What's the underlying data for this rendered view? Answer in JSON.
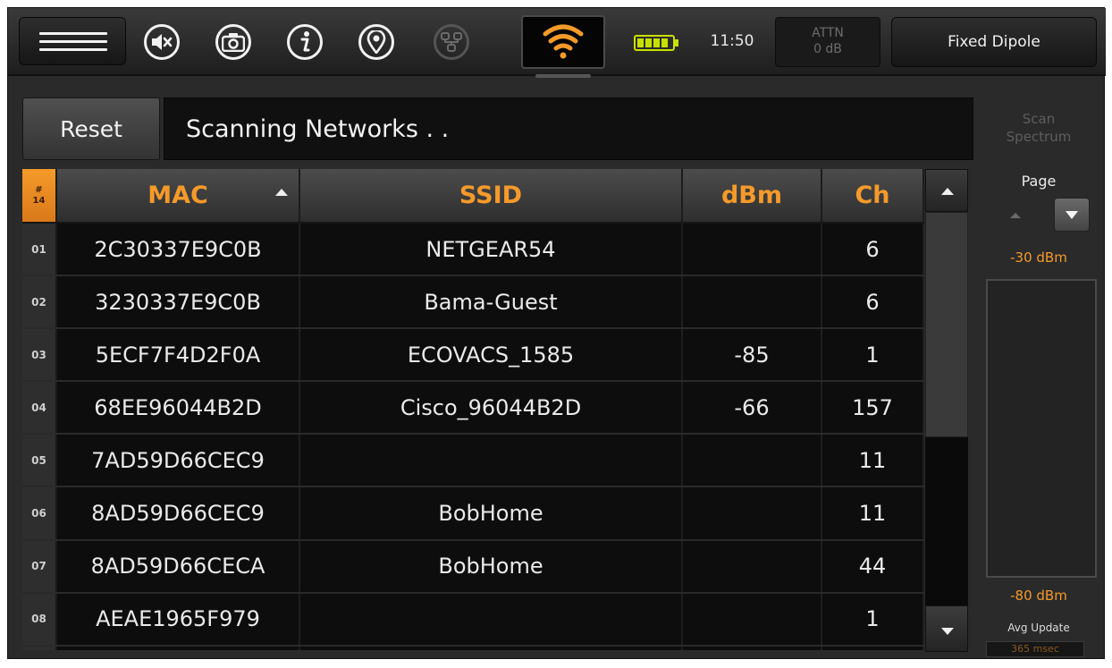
{
  "toolbar": {
    "icons": [
      "menu-icon",
      "mute-icon",
      "camera-icon",
      "info-icon",
      "location-icon",
      "network-icon",
      "wifi-icon",
      "battery-icon"
    ],
    "clock": "11:50",
    "attn_label": "ATTN",
    "attn_value": "0 dB",
    "antenna_mode": "Fixed Dipole"
  },
  "colors": {
    "accent": "#f59a2a",
    "panel": "#2a2a2a",
    "cell": "#0d0d0d",
    "battery": "#c8e000"
  },
  "controls": {
    "reset_label": "Reset",
    "status_text": "Scanning Networks . ."
  },
  "table": {
    "count_symbol": "#",
    "count": "14",
    "columns": [
      "MAC",
      "SSID",
      "dBm",
      "Ch"
    ],
    "sort_column": "MAC",
    "sort_direction": "ascending",
    "rows": [
      {
        "num": "01",
        "mac": "2C30337E9C0B",
        "ssid": "NETGEAR54",
        "dbm": "",
        "ch": "6"
      },
      {
        "num": "02",
        "mac": "3230337E9C0B",
        "ssid": "Bama-Guest",
        "dbm": "",
        "ch": "6"
      },
      {
        "num": "03",
        "mac": "5ECF7F4D2F0A",
        "ssid": "ECOVACS_1585",
        "dbm": "-85",
        "ch": "1"
      },
      {
        "num": "04",
        "mac": "68EE96044B2D",
        "ssid": "Cisco_96044B2D",
        "dbm": "-66",
        "ch": "157"
      },
      {
        "num": "05",
        "mac": "7AD59D66CEC9",
        "ssid": "",
        "dbm": "",
        "ch": "11"
      },
      {
        "num": "06",
        "mac": "8AD59D66CEC9",
        "ssid": "BobHome",
        "dbm": "",
        "ch": "11"
      },
      {
        "num": "07",
        "mac": "8AD59D66CECA",
        "ssid": "BobHome",
        "dbm": "",
        "ch": "44"
      },
      {
        "num": "08",
        "mac": "AEAE1965F979",
        "ssid": "",
        "dbm": "",
        "ch": "1"
      }
    ],
    "scroll_fraction_visible": 0.57
  },
  "side_panel": {
    "scan_spectrum_line1": "Scan",
    "scan_spectrum_line2": "Spectrum",
    "page_label": "Page",
    "top_dbm": "-30 dBm",
    "bottom_dbm": "-80 dBm",
    "avg_update_label": "Avg Update",
    "avg_update_value": "365 msec"
  }
}
